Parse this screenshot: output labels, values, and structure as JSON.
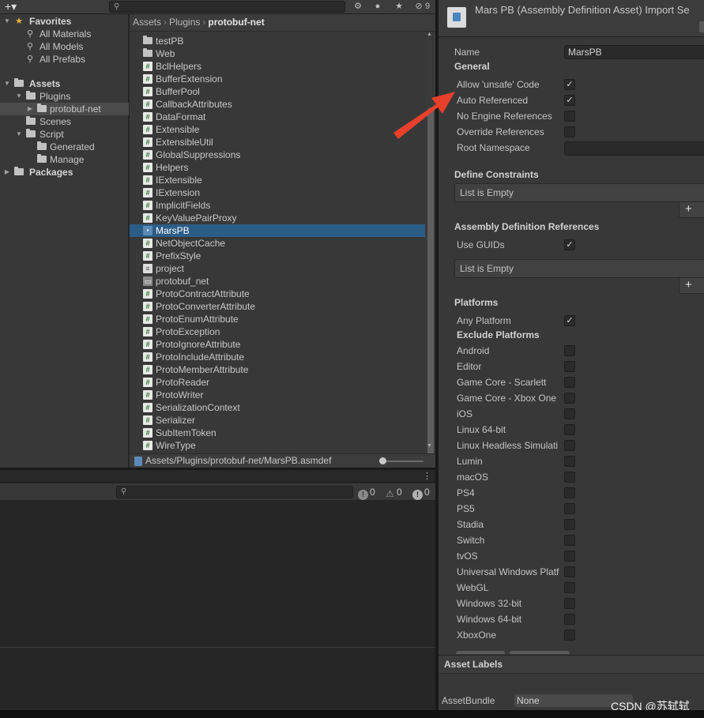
{
  "project_toolbar": {
    "add_label": "+▾",
    "hidden_count": "9"
  },
  "tree": [
    {
      "label": "Favorites",
      "icon": "star-icon",
      "arrow": "▼",
      "bold": true
    },
    {
      "label": "All Materials",
      "icon": "search-icon"
    },
    {
      "label": "All Models",
      "icon": "search-icon"
    },
    {
      "label": "All Prefabs",
      "icon": "search-icon"
    },
    {
      "label": "Assets",
      "icon": "folder-open-icon",
      "arrow": "▼",
      "bold": true
    },
    {
      "label": "Plugins",
      "icon": "folder-open-icon",
      "arrow": "▼"
    },
    {
      "label": "protobuf-net",
      "icon": "folder-icon",
      "arrow": "▶",
      "selected": true
    },
    {
      "label": "Scenes",
      "icon": "folder-icon"
    },
    {
      "label": "Script",
      "icon": "folder-open-icon",
      "arrow": "▼"
    },
    {
      "label": "Generated",
      "icon": "folder-icon"
    },
    {
      "label": "Manage",
      "icon": "folder-icon"
    },
    {
      "label": "Packages",
      "icon": "folder-icon",
      "arrow": "▶",
      "bold": true
    }
  ],
  "breadcrumb": {
    "items": [
      "Assets",
      "Plugins"
    ],
    "current": "protobuf-net",
    "separator": "›"
  },
  "files": [
    {
      "name": "testPB",
      "type": "folder"
    },
    {
      "name": "Web",
      "type": "folder"
    },
    {
      "name": "BclHelpers",
      "type": "cs"
    },
    {
      "name": "BufferExtension",
      "type": "cs"
    },
    {
      "name": "BufferPool",
      "type": "cs"
    },
    {
      "name": "CallbackAttributes",
      "type": "cs"
    },
    {
      "name": "DataFormat",
      "type": "cs"
    },
    {
      "name": "Extensible",
      "type": "cs"
    },
    {
      "name": "ExtensibleUtil",
      "type": "cs"
    },
    {
      "name": "GlobalSuppressions",
      "type": "cs"
    },
    {
      "name": "Helpers",
      "type": "cs"
    },
    {
      "name": "IExtensible",
      "type": "cs"
    },
    {
      "name": "IExtension",
      "type": "cs"
    },
    {
      "name": "ImplicitFields",
      "type": "cs"
    },
    {
      "name": "KeyValuePairProxy",
      "type": "cs"
    },
    {
      "name": "MarsPB",
      "type": "asm",
      "selected": true
    },
    {
      "name": "NetObjectCache",
      "type": "cs"
    },
    {
      "name": "PrefixStyle",
      "type": "cs"
    },
    {
      "name": "project",
      "type": "txt"
    },
    {
      "name": "protobuf_net",
      "type": "dll"
    },
    {
      "name": "ProtoContractAttribute",
      "type": "cs"
    },
    {
      "name": "ProtoConverterAttribute",
      "type": "cs"
    },
    {
      "name": "ProtoEnumAttribute",
      "type": "cs"
    },
    {
      "name": "ProtoException",
      "type": "cs"
    },
    {
      "name": "ProtoIgnoreAttribute",
      "type": "cs"
    },
    {
      "name": "ProtoIncludeAttribute",
      "type": "cs"
    },
    {
      "name": "ProtoMemberAttribute",
      "type": "cs"
    },
    {
      "name": "ProtoReader",
      "type": "cs"
    },
    {
      "name": "ProtoWriter",
      "type": "cs"
    },
    {
      "name": "SerializationContext",
      "type": "cs"
    },
    {
      "name": "Serializer",
      "type": "cs"
    },
    {
      "name": "SubItemToken",
      "type": "cs"
    },
    {
      "name": "WireType",
      "type": "cs"
    }
  ],
  "path_bar": "Assets/Plugins/protobuf-net/MarsPB.asmdef",
  "console": {
    "info_count": "0",
    "warn_count": "0",
    "error_count": "0"
  },
  "inspector": {
    "title": "Mars PB (Assembly Definition Asset) Import Se",
    "name_label": "Name",
    "name_value": "MarsPB",
    "general_header": "General",
    "general_options": [
      {
        "label": "Allow 'unsafe' Code",
        "checked": true
      },
      {
        "label": "Auto Referenced",
        "checked": true
      },
      {
        "label": "No Engine References",
        "checked": false
      },
      {
        "label": "Override References",
        "checked": false
      }
    ],
    "root_namespace_label": "Root Namespace",
    "define_constraints_header": "Define Constraints",
    "list_empty": "List is Empty",
    "plus": "+",
    "asm_refs_header": "Assembly Definition References",
    "use_guids_label": "Use GUIDs",
    "use_guids_checked": true,
    "platforms_header": "Platforms",
    "any_platform_label": "Any Platform",
    "any_platform_checked": true,
    "exclude_platforms_header": "Exclude Platforms",
    "platforms": [
      "Android",
      "Editor",
      "Game Core - Scarlett",
      "Game Core - Xbox One",
      "iOS",
      "Linux 64-bit",
      "Linux Headless Simulati",
      "Lumin",
      "macOS",
      "PS4",
      "PS5",
      "Stadia",
      "Switch",
      "tvOS",
      "Universal Windows Platf",
      "WebGL",
      "Windows 32-bit",
      "Windows 64-bit",
      "XboxOne"
    ],
    "asset_labels_header": "Asset Labels",
    "asset_bundle_label": "AssetBundle",
    "asset_bundle_value": "None"
  },
  "annotation": {
    "color": "#e8402a"
  },
  "watermark": "CSDN @苏轼轼"
}
